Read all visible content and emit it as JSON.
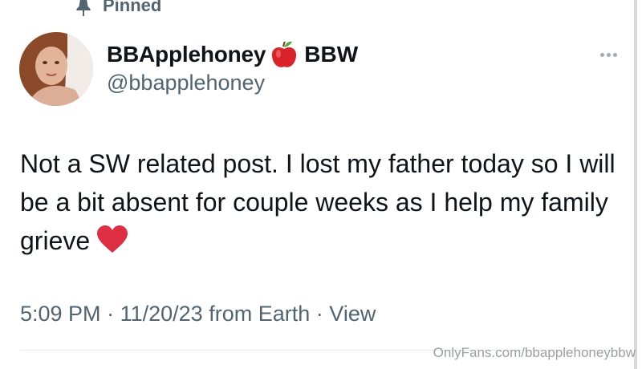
{
  "pinned": {
    "label": "Pinned",
    "icon": "pin-icon"
  },
  "author": {
    "display_name": "BBApplehoney",
    "name_emoji_icon": "red-apple-icon",
    "name_suffix": "BBW",
    "handle": "@bbapplehoney"
  },
  "more_menu": {
    "icon": "more-options-icon"
  },
  "tweet": {
    "text": "Not a SW related post. I lost my father today so I will be a bit absent for couple weeks as I help my family grieve",
    "emoji_icon": "red-heart-icon"
  },
  "meta": {
    "time": "5:09 PM",
    "date": "11/20/23",
    "location": "from Earth",
    "views_label": "View",
    "separator": "·"
  },
  "watermark": {
    "text": "OnlyFans.com/bbapplehoneybbw"
  },
  "colors": {
    "text_primary": "#0f1419",
    "text_secondary": "#536471",
    "heart": "#dd2e44",
    "apple": "#d8232a"
  }
}
